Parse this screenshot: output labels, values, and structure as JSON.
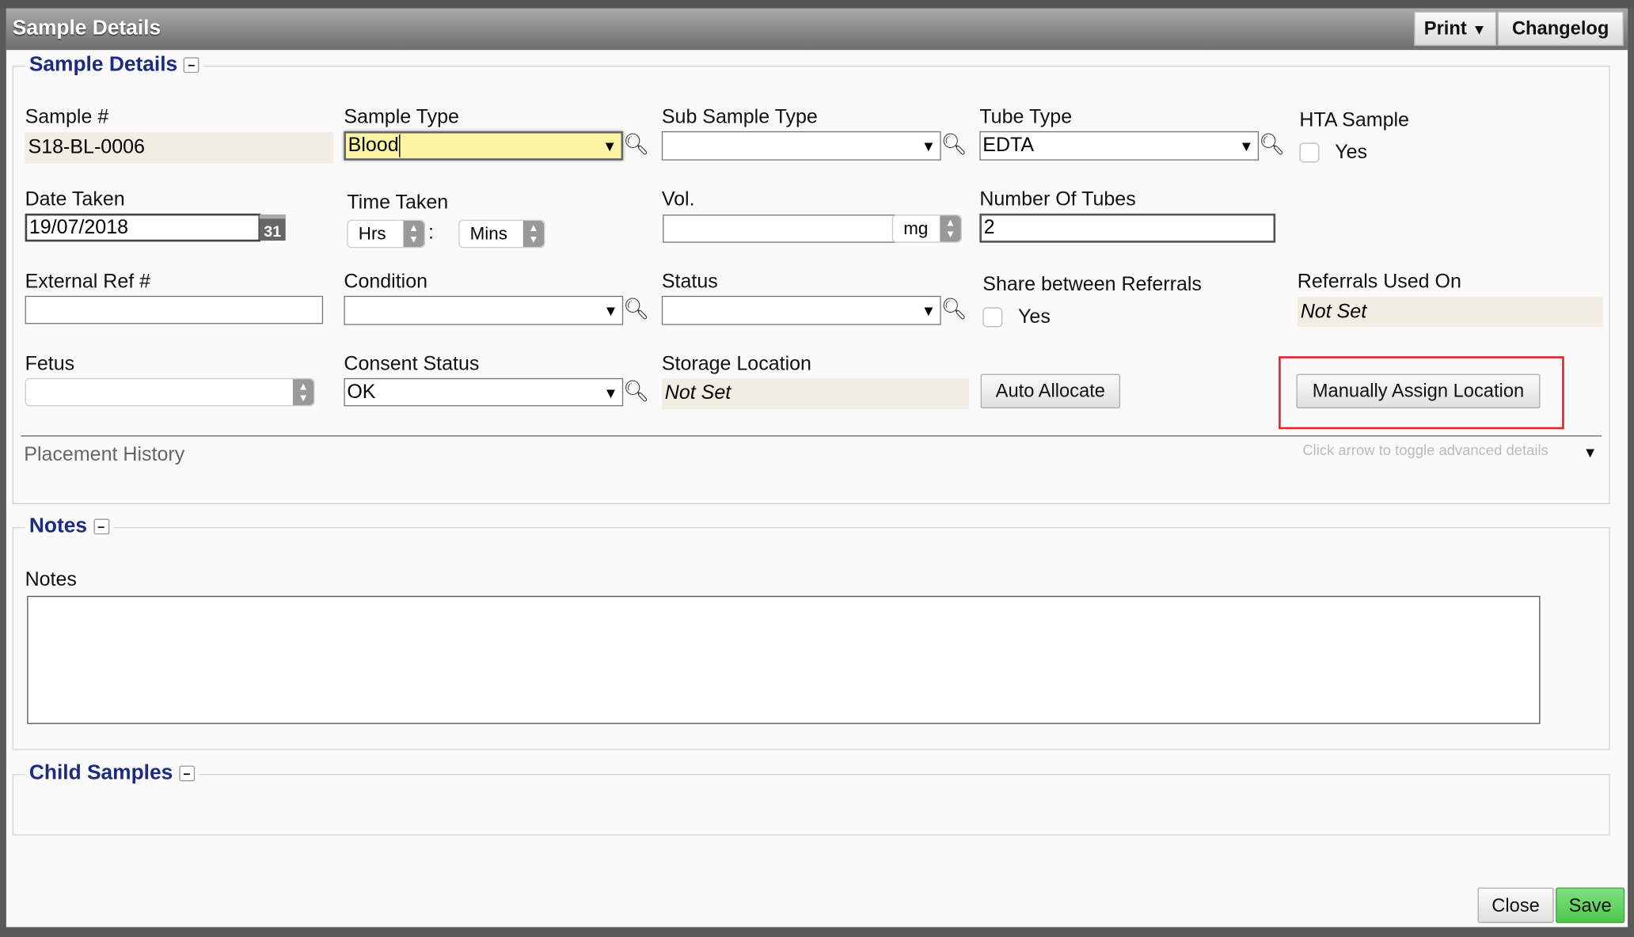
{
  "dialog": {
    "title": "Sample Details",
    "print_label": "Print",
    "changelog_label": "Changelog"
  },
  "sample_details": {
    "legend": "Sample Details",
    "sample_no": {
      "label": "Sample #",
      "value": "S18-BL-0006"
    },
    "sample_type": {
      "label": "Sample Type",
      "value": "Blood"
    },
    "sub_sample_type": {
      "label": "Sub Sample Type",
      "value": ""
    },
    "tube_type": {
      "label": "Tube Type",
      "value": "EDTA"
    },
    "hta_sample": {
      "label": "HTA Sample",
      "option": "Yes",
      "checked": false
    },
    "date_taken": {
      "label": "Date Taken",
      "value": "19/07/2018",
      "calendar_day": "31"
    },
    "time_taken": {
      "label": "Time Taken",
      "hours": "Hrs",
      "separator": ":",
      "minutes": "Mins"
    },
    "vol": {
      "label": "Vol.",
      "value": "",
      "unit": "mg"
    },
    "number_of_tubes": {
      "label": "Number Of Tubes",
      "value": "2"
    },
    "external_ref": {
      "label": "External Ref #",
      "value": ""
    },
    "condition": {
      "label": "Condition",
      "value": ""
    },
    "status": {
      "label": "Status",
      "value": ""
    },
    "share_between_referrals": {
      "label": "Share between Referrals",
      "option": "Yes",
      "checked": false
    },
    "referrals_used_on": {
      "label": "Referrals Used On",
      "value": "Not Set"
    },
    "fetus": {
      "label": "Fetus",
      "value": ""
    },
    "consent_status": {
      "label": "Consent Status",
      "value": "OK"
    },
    "storage_location": {
      "label": "Storage Location",
      "value": "Not Set"
    },
    "auto_allocate_label": "Auto Allocate",
    "manually_assign_label": "Manually Assign Location",
    "placement_history": "Placement History",
    "toggle_hint": "Click arrow to toggle advanced details"
  },
  "notes": {
    "legend": "Notes",
    "label": "Notes",
    "value": ""
  },
  "child_samples": {
    "legend": "Child Samples"
  },
  "footer": {
    "close_label": "Close",
    "save_label": "Save"
  },
  "colors": {
    "legend": "#1b2a83",
    "highlight_border": "#e0252b",
    "save": "#5fd35f",
    "focused_field": "#fdf5a6"
  }
}
